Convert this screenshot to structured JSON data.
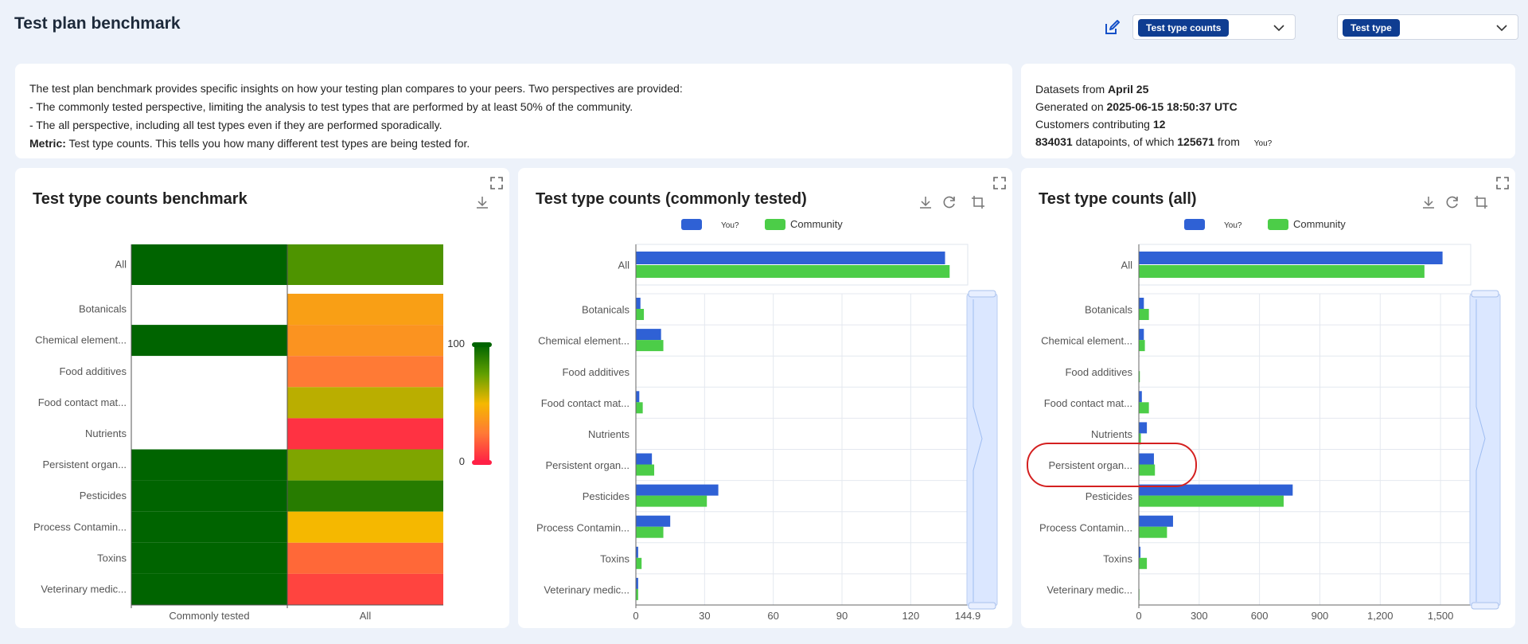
{
  "header": {
    "title": "Test plan benchmark",
    "metric_select": "Test type counts",
    "dimension_select": "Test type"
  },
  "description": {
    "line1": "The test plan benchmark provides specific insights on how your testing plan compares to your peers. Two perspectives are provided:",
    "line2": "- The commonly tested perspective, limiting the analysis to test types that are performed by at least 50% of the community.",
    "line3": "- The all perspective, including all test types even if they are performed sporadically.",
    "metric_label": "Metric:",
    "metric_text": " Test type counts. This tells you how many different test types are being tested for."
  },
  "meta": {
    "datasets_label": "Datasets from ",
    "datasets_value": "April 25",
    "generated_label": "Generated on ",
    "generated_value": "2025-06-15 18:50:37 UTC",
    "customers_label": "Customers contributing ",
    "customers_value": "12",
    "datapoints_value": "834031",
    "datapoints_mid": " datapoints, of which ",
    "datapoints_own": "125671",
    "datapoints_from": " from ",
    "you_label": "You?"
  },
  "categories_all": [
    "All"
  ],
  "categories": [
    "Botanicals",
    "Chemical element...",
    "Food additives",
    "Food contact mat...",
    "Nutrients",
    "Persistent organ...",
    "Pesticides",
    "Process Contamin...",
    "Toxins",
    "Veterinary medic..."
  ],
  "chart_data": [
    {
      "type": "heatmap",
      "title": "Test type counts benchmark",
      "x_categories": [
        "Commonly tested",
        "All"
      ],
      "y_categories": [
        "All",
        "Botanicals",
        "Chemical element...",
        "Food additives",
        "Food contact mat...",
        "Nutrients",
        "Persistent organ...",
        "Pesticides",
        "Process Contamin...",
        "Toxins",
        "Veterinary medic..."
      ],
      "values": {
        "Commonly tested": [
          100,
          null,
          100,
          null,
          null,
          null,
          100,
          100,
          100,
          100,
          100
        ],
        "All": [
          80,
          40,
          35,
          25,
          60,
          5,
          70,
          90,
          50,
          20,
          10
        ]
      },
      "visual_map": {
        "min": 0,
        "max": 100,
        "min_label": "0",
        "max_label": "100",
        "colors": [
          "#ff2045",
          "#ff7a35",
          "#f5b800",
          "#62a000",
          "#006400"
        ]
      }
    },
    {
      "type": "bar",
      "title": "Test type counts (commonly tested)",
      "legend": [
        "You?",
        "Community"
      ],
      "colors": [
        "#2f61d5",
        "#4ccd48"
      ],
      "all_values": {
        "You?": 135,
        "Community": 137
      },
      "categories": [
        "Botanicals",
        "Chemical element...",
        "Food additives",
        "Food contact mat...",
        "Nutrients",
        "Persistent organ...",
        "Pesticides",
        "Process Contamin...",
        "Toxins",
        "Veterinary medic..."
      ],
      "series": [
        {
          "name": "You?",
          "values": [
            2,
            11,
            0,
            1.5,
            0,
            7,
            36,
            15,
            1,
            1
          ]
        },
        {
          "name": "Community",
          "values": [
            3.5,
            12,
            0,
            3,
            0,
            8,
            31,
            12,
            2.5,
            1
          ]
        }
      ],
      "xlim": [
        0,
        144.9
      ],
      "x_ticks": [
        "0",
        "30",
        "60",
        "90",
        "120",
        "144.9"
      ]
    },
    {
      "type": "bar",
      "title": "Test type counts (all)",
      "legend": [
        "You?",
        "Community"
      ],
      "colors": [
        "#2f61d5",
        "#4ccd48"
      ],
      "all_values": {
        "You?": 1510,
        "Community": 1420
      },
      "categories": [
        "Botanicals",
        "Chemical element...",
        "Food additives",
        "Food contact mat...",
        "Nutrients",
        "Persistent organ...",
        "Pesticides",
        "Process Contamin...",
        "Toxins",
        "Veterinary medic..."
      ],
      "series": [
        {
          "name": "You?",
          "values": [
            25,
            25,
            0,
            15,
            40,
            75,
            765,
            170,
            8,
            0
          ]
        },
        {
          "name": "Community",
          "values": [
            50,
            30,
            5,
            50,
            10,
            80,
            720,
            140,
            40,
            3
          ]
        }
      ],
      "xlim": [
        0,
        1650
      ],
      "x_ticks": [
        "0",
        "300",
        "600",
        "900",
        "1,200",
        "1,500"
      ],
      "highlight_category": "Persistent organ..."
    }
  ]
}
